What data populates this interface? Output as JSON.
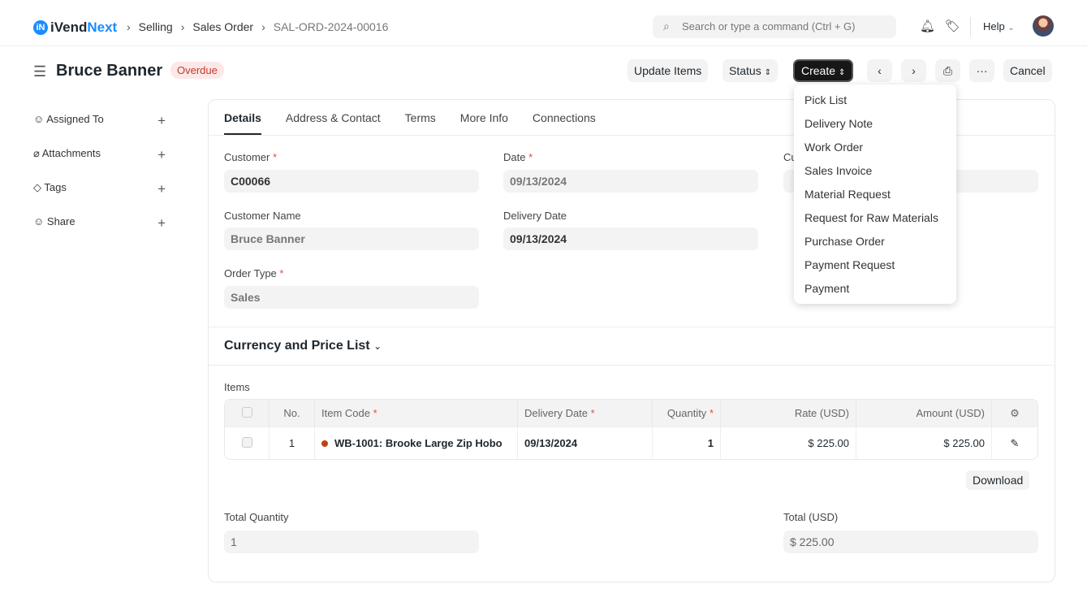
{
  "nav": {
    "logo_prefix": "iVend",
    "logo_suffix": "Next",
    "breadcrumbs": [
      "Selling",
      "Sales Order",
      "SAL-ORD-2024-00016"
    ],
    "search_placeholder": "Search or type a command (Ctrl + G)",
    "help": "Help"
  },
  "header": {
    "title": "Bruce Banner",
    "status": "Overdue",
    "buttons": {
      "update_items": "Update Items",
      "status": "Status",
      "create": "Create",
      "cancel": "Cancel"
    }
  },
  "sidebar": {
    "items": [
      {
        "label": "Assigned To"
      },
      {
        "label": "Attachments"
      },
      {
        "label": "Tags"
      },
      {
        "label": "Share"
      }
    ]
  },
  "tabs": [
    "Details",
    "Address & Contact",
    "Terms",
    "More Info",
    "Connections"
  ],
  "form": {
    "customer_label": "Customer",
    "customer": "C00066",
    "date_label": "Date",
    "date": "09/13/2024",
    "third_label": "Cu",
    "customer_name_label": "Customer Name",
    "customer_name": "Bruce Banner",
    "delivery_date_label": "Delivery Date",
    "delivery_date": "09/13/2024",
    "order_type_label": "Order Type",
    "order_type": "Sales"
  },
  "section": {
    "currency": "Currency and Price List"
  },
  "items": {
    "label": "Items",
    "headers": [
      "No.",
      "Item Code",
      "Delivery Date",
      "Quantity",
      "Rate (USD)",
      "Amount (USD)"
    ],
    "rows": [
      {
        "no": "1",
        "item_code": "WB-1001: Brooke Large Zip Hobo",
        "delivery_date": "09/13/2024",
        "quantity": "1",
        "rate": "$ 225.00",
        "amount": "$ 225.00"
      }
    ],
    "download": "Download"
  },
  "totals": {
    "qty_label": "Total Quantity",
    "qty": "1",
    "total_label": "Total (USD)",
    "total": "$ 225.00"
  },
  "create_menu": [
    "Pick List",
    "Delivery Note",
    "Work Order",
    "Sales Invoice",
    "Material Request",
    "Request for Raw Materials",
    "Purchase Order",
    "Payment Request",
    "Payment"
  ]
}
